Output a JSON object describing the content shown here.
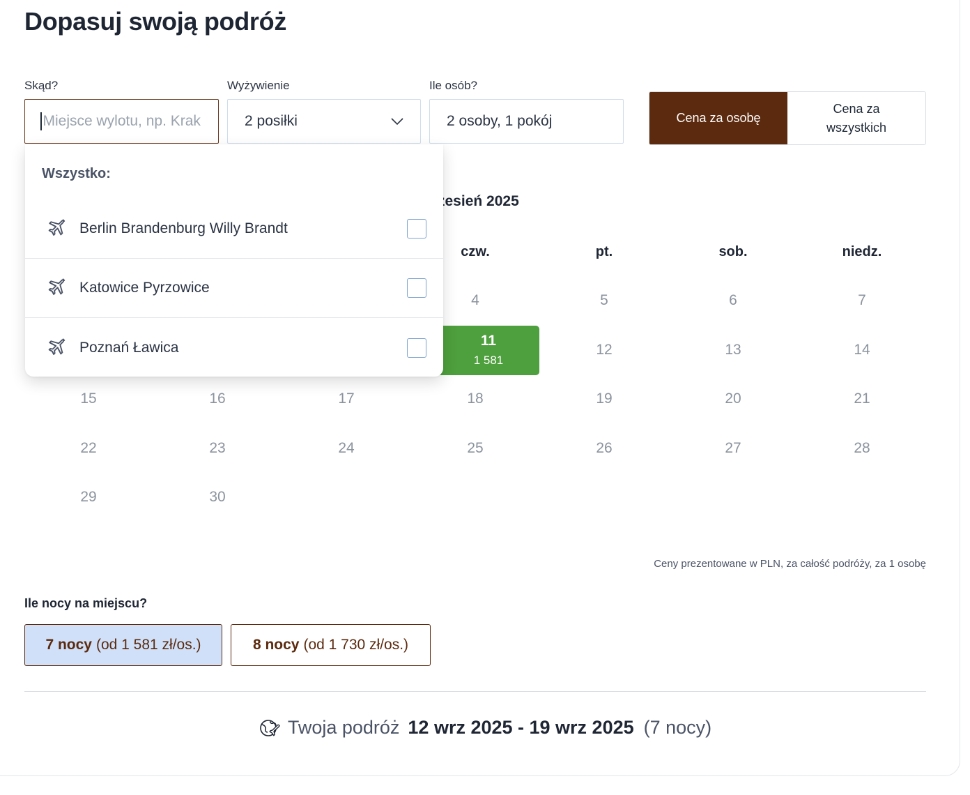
{
  "page": {
    "title": "Dopasuj swoją podróż"
  },
  "filters": {
    "from": {
      "label": "Skąd?",
      "placeholder": "Miejsce wylotu, np. Krak",
      "value": ""
    },
    "board": {
      "label": "Wyżywienie",
      "value": "2 posiłki"
    },
    "persons": {
      "label": "Ile osób?",
      "value": "2 osoby, 1 pokój"
    }
  },
  "price_toggle": {
    "per_person": "Cena za osobę",
    "all_line1": "Cena za",
    "all_line2": "wszystkich",
    "selected": "per_person"
  },
  "airport_dropdown": {
    "title": "Wszystko:",
    "options": [
      {
        "label": "Berlin Brandenburg Willy Brandt",
        "checked": false
      },
      {
        "label": "Katowice Pyrzowice",
        "checked": false
      },
      {
        "label": "Poznań Ławica",
        "checked": false
      }
    ]
  },
  "calendar": {
    "month_title": "zesień 2025",
    "weekdays": [
      "czw.",
      "pt.",
      "sob.",
      "niedz."
    ],
    "days": {
      "d4": "4",
      "d5": "5",
      "d6": "6",
      "d7": "7",
      "d11": "11",
      "d12": "12",
      "d13": "13",
      "d14": "14",
      "d15": "15",
      "d16": "16",
      "d17": "17",
      "d18": "18",
      "d19": "19",
      "d20": "20",
      "d21": "21",
      "d22": "22",
      "d23": "23",
      "d24": "24",
      "d25": "25",
      "d26": "26",
      "d27": "27",
      "d28": "28",
      "d29": "29",
      "d30": "30"
    },
    "selected_price": "1 581",
    "price_note": "Ceny prezentowane w PLN, za całość podróży, za 1 osobę"
  },
  "nights": {
    "label": "Ile nocy na miejscu?",
    "options": [
      {
        "nights": "7 nocy",
        "price": "(od 1 581 zł/os.)",
        "selected": true
      },
      {
        "nights": "8 nocy",
        "price": "(od 1 730 zł/os.)",
        "selected": false
      }
    ]
  },
  "summary": {
    "prefix": "Twoja podróż",
    "dates": "12 wrz 2025 - 19 wrz 2025",
    "nights": "(7 nocy)"
  },
  "colors": {
    "accent_brown": "#5c2a0e",
    "selected_green": "#4e9f3d",
    "selected_night_bg": "#cfe0f8"
  }
}
